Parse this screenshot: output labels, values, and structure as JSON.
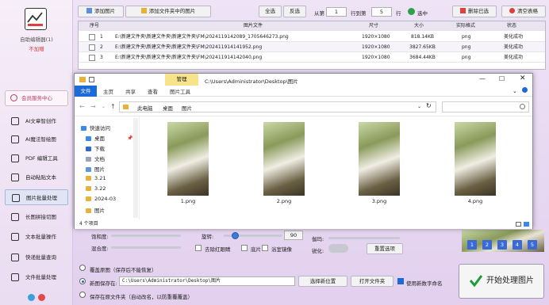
{
  "app": {
    "name": "自助编辑器(1)",
    "unregistered": "不加赠",
    "service_center": "会员服务中心"
  },
  "sidebar": {
    "items": [
      {
        "label": "AI文章智创作"
      },
      {
        "label": "AI魔法智绘图"
      },
      {
        "label": "PDF 编辑工具"
      },
      {
        "label": "自动粘贴文本"
      },
      {
        "label": "图片批量处理"
      },
      {
        "label": "长图拼接切图"
      },
      {
        "label": "文本批量操作"
      },
      {
        "label": "快递批量查询"
      },
      {
        "label": "文件批量处理"
      }
    ]
  },
  "toolbar": {
    "add_image": "添加图片",
    "add_folder_images": "添加文件夹中的图片",
    "select_all": "全选",
    "invert": "反选",
    "from_row_label": "从第",
    "from_row_value": "1",
    "to_row_label": "行到第",
    "to_row_value": "5",
    "row_suffix": "行",
    "select_label": "选中",
    "delete_selected": "删除已选",
    "clear_table": "清空表格"
  },
  "table": {
    "headers": [
      "序号",
      "图片文件",
      "尺寸",
      "大小",
      "实际格式",
      "状态"
    ],
    "rows": [
      {
        "no": "1",
        "file": "E:\\新建文件夹\\新建文件夹\\新建文件夹\\FM\\2024119142089_1705646273.png",
        "size": "1920×1080",
        "bytes": "818.14KB",
        "format": "png",
        "status": "美化成功"
      },
      {
        "no": "2",
        "file": "E:\\新建文件夹\\新建文件夹\\新建文件夹\\FM\\202411914141952.png",
        "size": "1920×1080",
        "bytes": "3827.65KB",
        "format": "png",
        "status": "美化成功"
      },
      {
        "no": "3",
        "file": "E:\\新建文件夹\\新建文件夹\\新建文件夹\\FM\\202411914142040.png",
        "size": "1920×1080",
        "bytes": "3684.44KB",
        "format": "png",
        "status": "美化成功"
      }
    ]
  },
  "explorer": {
    "title": "C:\\Users\\Administrator\\Desktop\\图片",
    "manage_tab": "管理",
    "tabs": [
      "文件",
      "主页",
      "共享",
      "查看",
      "图片工具"
    ],
    "breadcrumb": [
      "此电脑",
      "桌面",
      "图片"
    ],
    "nav": [
      {
        "label": "快速访问"
      },
      {
        "label": "桌面"
      },
      {
        "label": "下载"
      },
      {
        "label": "文档"
      },
      {
        "label": "图片"
      },
      {
        "label": "3.21"
      },
      {
        "label": "3.22"
      },
      {
        "label": "2024-03"
      },
      {
        "label": "图片"
      }
    ],
    "files": [
      "1.png",
      "2.png",
      "3.png",
      "4.png"
    ],
    "status": "4 个项目"
  },
  "adjust": {
    "brightness": "饱和度:",
    "saturation": "混合度:",
    "rotate": "旋转:",
    "rotate_value": "90",
    "gamma": "伽玛:",
    "sharpen": "锐化:",
    "remove_red_eye": "去除红眼睛",
    "film": "底片",
    "bath_mirror": "浴室镜像",
    "reset": "重置选项"
  },
  "pages": [
    "1",
    "2",
    "3",
    "4",
    "5"
  ],
  "output": {
    "overwrite": "覆盖原图（保存后不能恢复）",
    "save_to": "新图保存在:",
    "save_path": "C:\\Users\\Administrator\\Desktop\\图片",
    "choose_location": "选择新位置",
    "open_folder": "打开文件夹",
    "use_new_digit_name": "使用新数字命名",
    "save_in_original": "保存在原文件夹（自动改名，以防重覆覆盖）",
    "start": "开始处理图片"
  }
}
